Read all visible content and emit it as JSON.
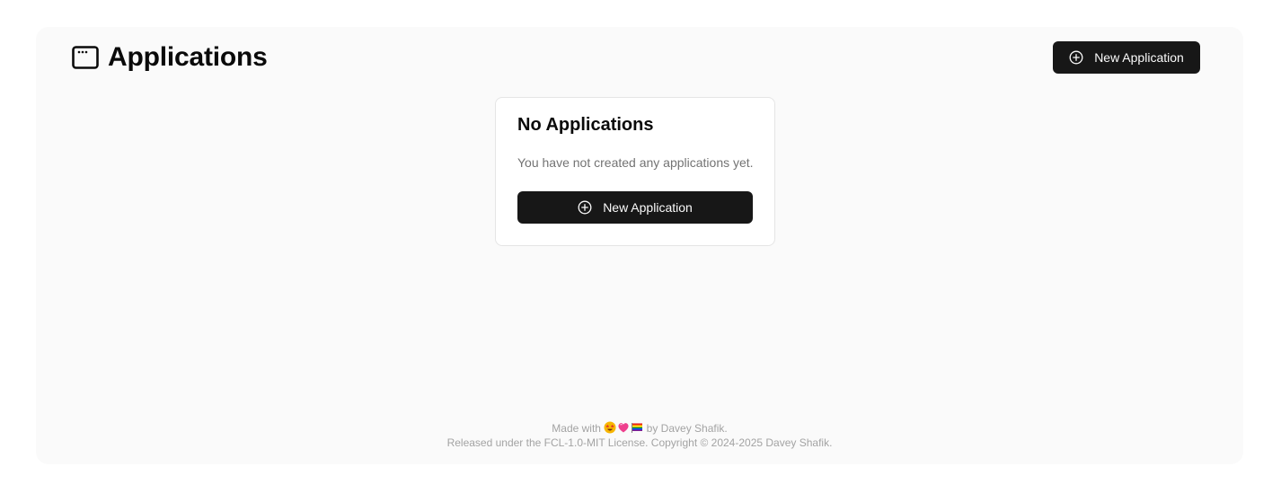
{
  "header": {
    "title": "Applications",
    "title_icon": "app-window-icon",
    "new_button_label": "New Application",
    "new_button_icon": "plus-circle-icon"
  },
  "empty_state": {
    "title": "No Applications",
    "description": "You have not created any applications yet.",
    "button_label": "New Application",
    "button_icon": "plus-circle-icon"
  },
  "footer": {
    "made_with_prefix": "Made with",
    "made_with_icons": [
      "star-struck-emoji-icon",
      "heart-emoji-icon",
      "rainbow-flag-emoji-icon"
    ],
    "made_with_suffix": "by Davey Shafik.",
    "license_text": "Released under the FCL-1.0-MIT License. Copyright © 2024-2025 Davey Shafik."
  },
  "colors": {
    "page_background": "#ffffff",
    "panel_background": "#fafafa",
    "button_background": "#171717",
    "button_text": "#fafafa",
    "muted_text": "#737373",
    "footer_text": "#a3a3a3",
    "card_border": "#e5e5e5"
  }
}
